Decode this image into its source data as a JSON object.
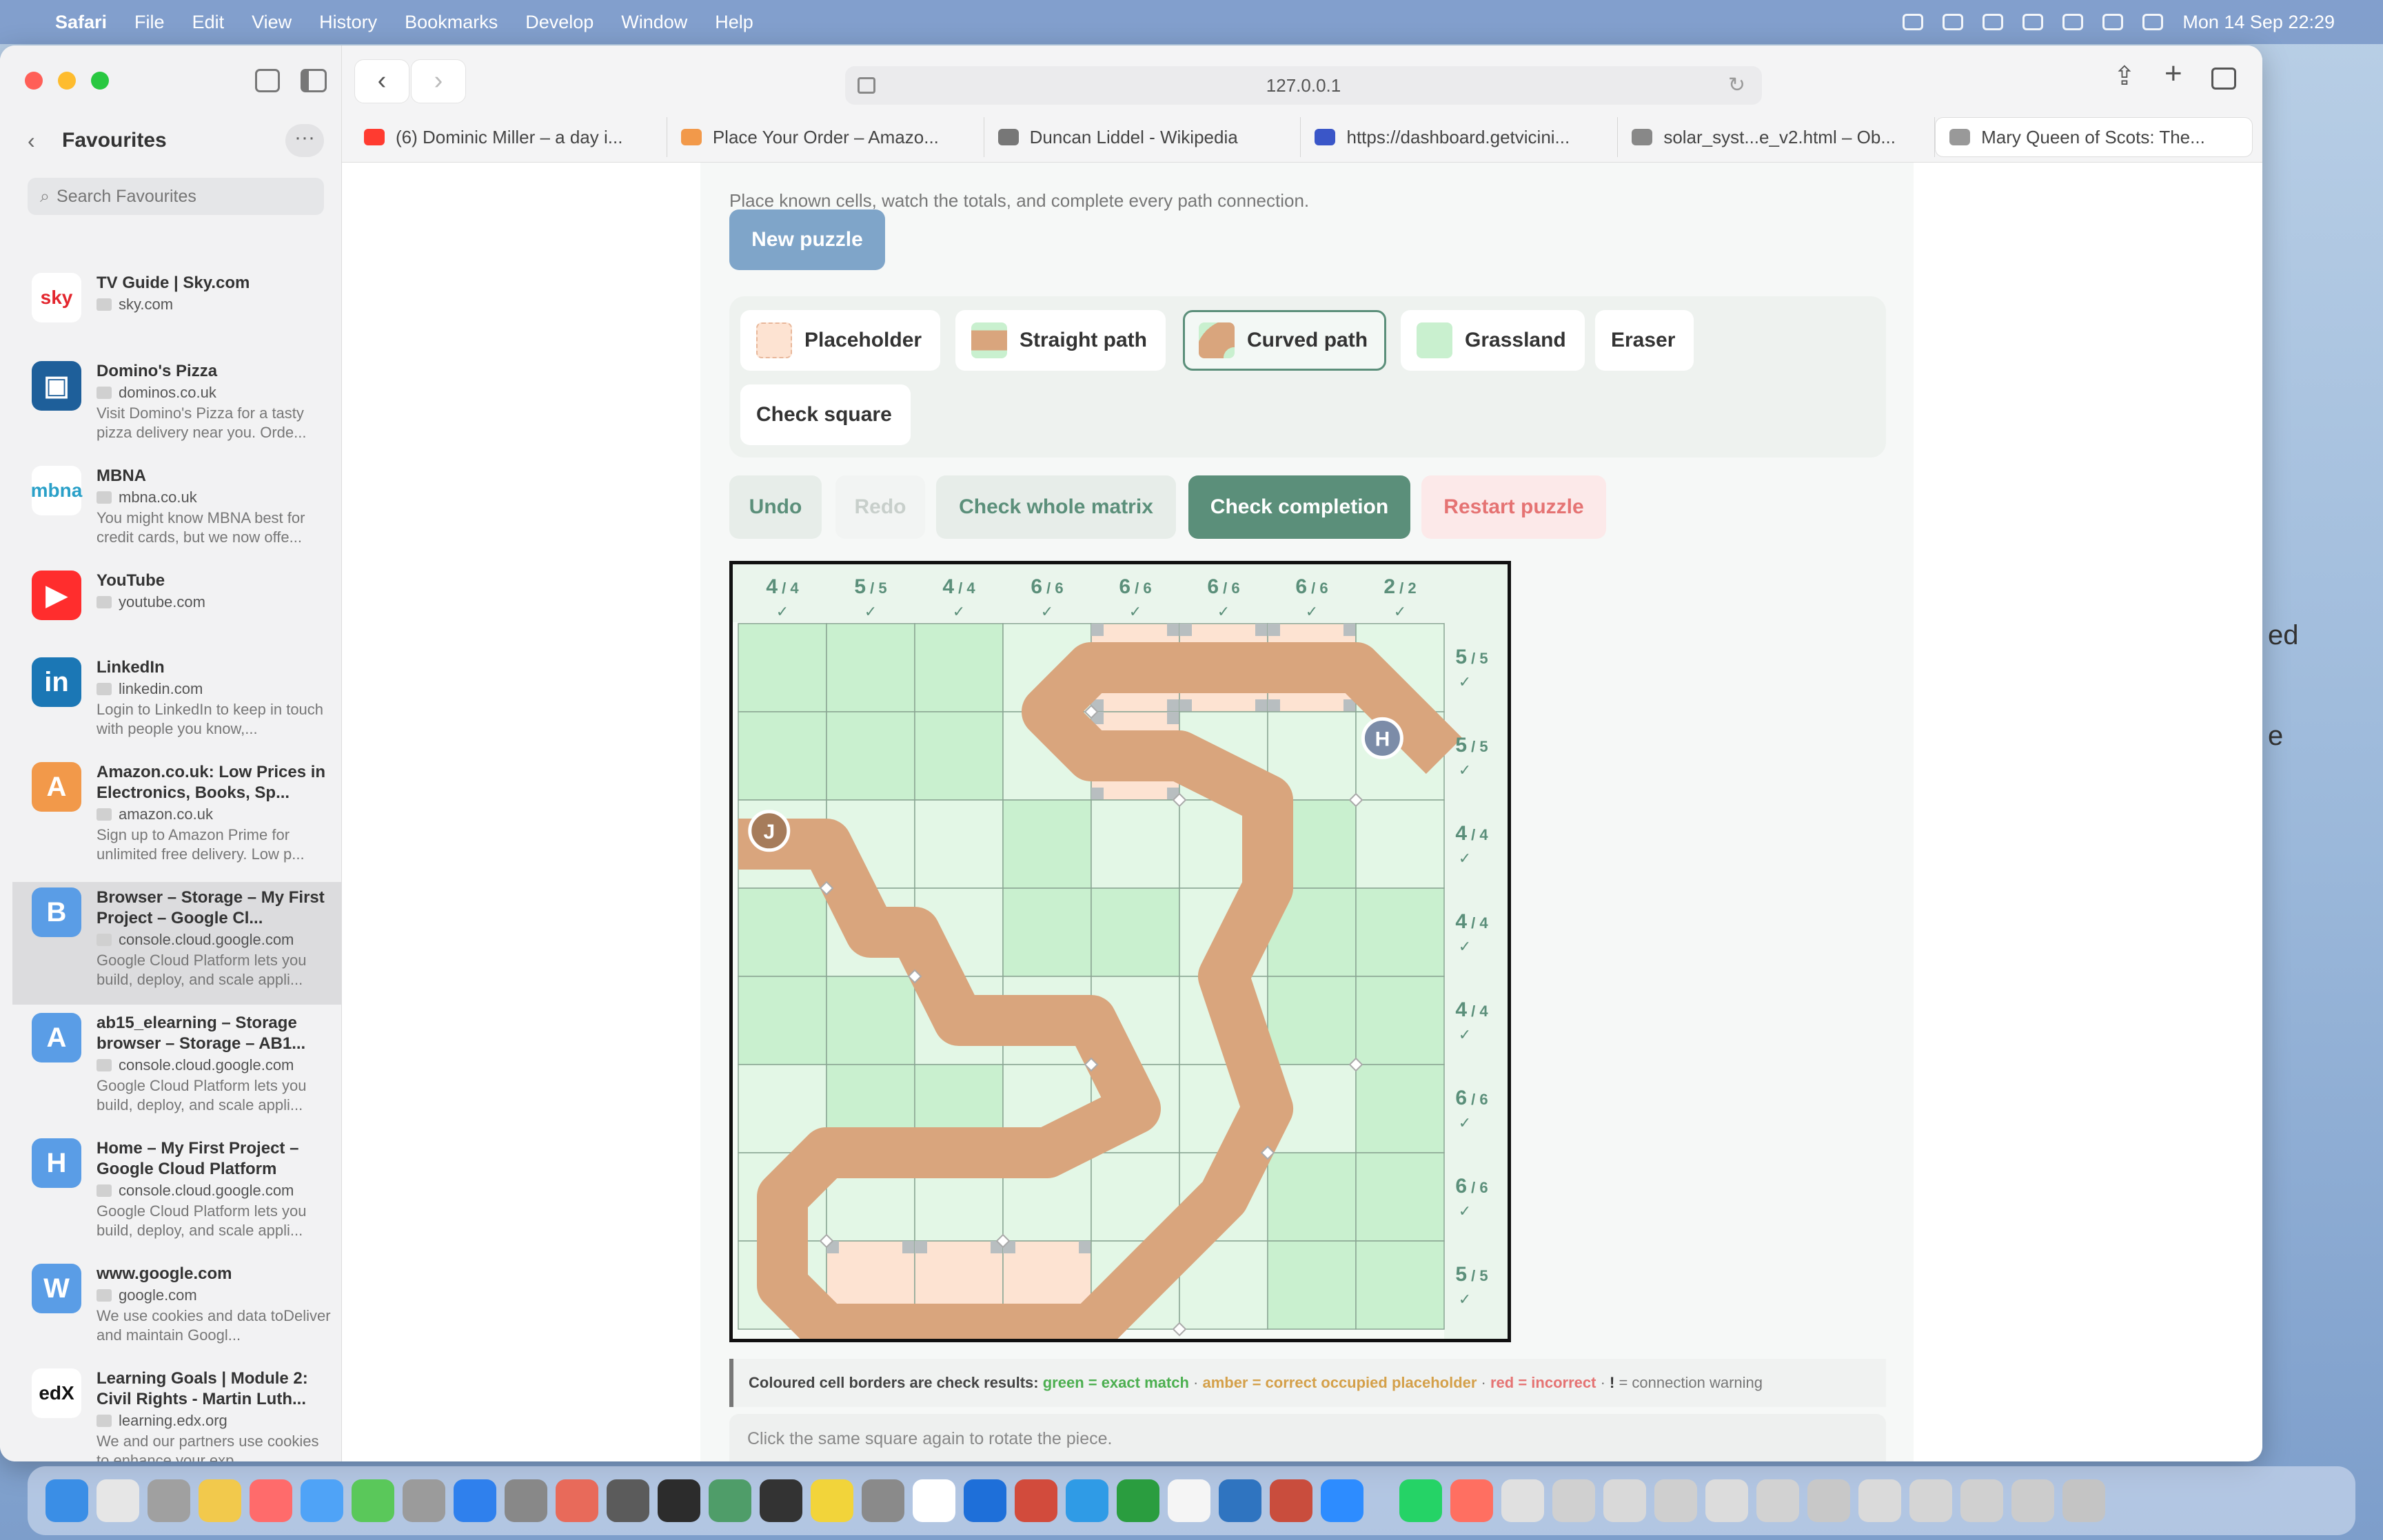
{
  "menubar": {
    "app": "Safari",
    "items": [
      "File",
      "Edit",
      "View",
      "History",
      "Bookmarks",
      "Develop",
      "Window",
      "Help"
    ],
    "clock": "Mon 14 Sep  22:29"
  },
  "sidebar": {
    "title": "Favourites",
    "search_placeholder": "Search Favourites",
    "items": [
      {
        "title": "TV Guide | Sky.com",
        "domain": "sky.com",
        "desc": "",
        "logo": "sky",
        "color": "#ffffff",
        "fg": "#e3262e"
      },
      {
        "title": "Domino's Pizza",
        "domain": "dominos.co.uk",
        "desc": "Visit Domino's Pizza for a tasty pizza delivery near you. Orde...",
        "logo": "▣",
        "color": "#1e5f9a",
        "fg": "#ffffff"
      },
      {
        "title": "MBNA",
        "domain": "mbna.co.uk",
        "desc": "You might know MBNA best for credit cards, but we now offe...",
        "logo": "mbna",
        "color": "#ffffff",
        "fg": "#2aa0c8"
      },
      {
        "title": "YouTube",
        "domain": "youtube.com",
        "desc": "",
        "logo": "▶",
        "color": "#ff2d2d",
        "fg": "#ffffff"
      },
      {
        "title": "LinkedIn",
        "domain": "linkedin.com",
        "desc": "Login to LinkedIn to keep in touch with people you know,...",
        "logo": "in",
        "color": "#1b77b5",
        "fg": "#ffffff"
      },
      {
        "title": "Amazon.co.uk: Low Prices in Electronics, Books, Sp...",
        "domain": "amazon.co.uk",
        "desc": "Sign up to Amazon Prime for unlimited free delivery. Low p...",
        "logo": "A",
        "color": "#f2994a",
        "fg": "#ffffff"
      },
      {
        "title": "Browser – Storage – My First Project – Google Cl...",
        "domain": "console.cloud.google.com",
        "desc": "Google Cloud Platform lets you build, deploy, and scale appli...",
        "logo": "B",
        "color": "#5a9de6",
        "fg": "#ffffff"
      },
      {
        "title": "ab15_elearning – Storage browser – Storage – AB1...",
        "domain": "console.cloud.google.com",
        "desc": "Google Cloud Platform lets you build, deploy, and scale appli...",
        "logo": "A",
        "color": "#5a9de6",
        "fg": "#ffffff"
      },
      {
        "title": "Home – My First Project – Google Cloud Platform",
        "domain": "console.cloud.google.com",
        "desc": "Google Cloud Platform lets you build, deploy, and scale appli...",
        "logo": "H",
        "color": "#5a9de6",
        "fg": "#ffffff"
      },
      {
        "title": "www.google.com",
        "domain": "google.com",
        "desc": "We use cookies and data toDeliver and maintain Googl...",
        "logo": "W",
        "color": "#5a9de6",
        "fg": "#ffffff"
      },
      {
        "title": "Learning Goals | Module 2: Civil Rights - Martin Luth...",
        "domain": "learning.edx.org",
        "desc": "We and our partners use cookies to enhance your exp...",
        "logo": "edX",
        "color": "#ffffff",
        "fg": "#111111"
      }
    ]
  },
  "browser": {
    "url": "127.0.0.1",
    "tabs": [
      {
        "label": "(6) Dominic Miller – a day i...",
        "color": "#ff3b30"
      },
      {
        "label": "Place Your Order – Amazo...",
        "color": "#f2994a"
      },
      {
        "label": "Duncan Liddel - Wikipedia",
        "color": "#777777"
      },
      {
        "label": "https://dashboard.getvicini...",
        "color": "#3a56c8"
      },
      {
        "label": "solar_syst...e_v2.html – Ob...",
        "color": "#888888"
      },
      {
        "label": "Mary Queen of Scots: The...",
        "color": "#999999"
      }
    ]
  },
  "page": {
    "subtitle": "Place known cells, watch the totals, and complete every path connection.",
    "new_puzzle": "New puzzle",
    "tools": {
      "placeholder": "Placeholder",
      "straight": "Straight path",
      "curved": "Curved path",
      "grassland": "Grassland",
      "eraser": "Eraser",
      "check_square": "Check square"
    },
    "actions": {
      "undo": "Undo",
      "redo": "Redo",
      "check_matrix": "Check whole matrix",
      "check_completion": "Check completion",
      "restart": "Restart puzzle"
    },
    "legend": {
      "intro": "Coloured cell borders are check results: ",
      "green": "green = exact match",
      "sep": " · ",
      "amber": "amber = correct occupied placeholder",
      "red": "red = incorrect",
      "warn_mark": "!",
      "warn": " = connection warning"
    },
    "hint": "Click the same square again to rotate the piece.",
    "markers": {
      "start": "J",
      "end": "H"
    }
  },
  "grid": {
    "col_totals": [
      {
        "v": "4",
        "t": "4"
      },
      {
        "v": "5",
        "t": "5"
      },
      {
        "v": "4",
        "t": "4"
      },
      {
        "v": "6",
        "t": "6"
      },
      {
        "v": "6",
        "t": "6"
      },
      {
        "v": "6",
        "t": "6"
      },
      {
        "v": "6",
        "t": "6"
      },
      {
        "v": "2",
        "t": "2"
      }
    ],
    "row_totals": [
      {
        "v": "5",
        "t": "5"
      },
      {
        "v": "5",
        "t": "5"
      },
      {
        "v": "4",
        "t": "4"
      },
      {
        "v": "4",
        "t": "4"
      },
      {
        "v": "4",
        "t": "4"
      },
      {
        "v": "6",
        "t": "6"
      },
      {
        "v": "6",
        "t": "6"
      },
      {
        "v": "5",
        "t": "5"
      }
    ],
    "check_mark": "✓",
    "cells": [
      "GGGpPPPp",
      "GGGpPpgp",
      "pppGgpGp",
      "GppGGpGG",
      "GGppgpGG",
      "pGGppppG",
      "pppppgGG",
      "pPPPppGG"
    ],
    "path": [
      [
        0,
        2.5
      ],
      [
        1,
        2.5
      ],
      [
        1.5,
        3.5
      ],
      [
        2,
        3.5
      ],
      [
        2.5,
        4.5
      ],
      [
        4,
        4.5
      ],
      [
        4.5,
        5.5
      ],
      [
        3.5,
        6
      ],
      [
        1,
        6
      ],
      [
        0.5,
        6.5
      ],
      [
        0.5,
        7.5
      ],
      [
        1,
        8
      ],
      [
        4,
        8
      ],
      [
        4.5,
        7.5
      ],
      [
        5.5,
        6.5
      ],
      [
        6,
        5.5
      ],
      [
        5.5,
        4
      ],
      [
        6,
        3
      ],
      [
        6,
        2
      ],
      [
        5,
        1.5
      ],
      [
        4,
        1.5
      ],
      [
        3.5,
        1
      ],
      [
        4,
        0.5
      ],
      [
        7,
        0.5
      ],
      [
        7.5,
        1
      ],
      [
        8,
        1.5
      ]
    ]
  },
  "colors": {
    "accent": "#5b8f7a",
    "grass": "#c9f0cf",
    "light_grass": "#e3f7e6",
    "placeholder": "#fde3d2",
    "path": "#d9a57d",
    "restart": "#e57373",
    "blue": "#7fa5c9"
  }
}
